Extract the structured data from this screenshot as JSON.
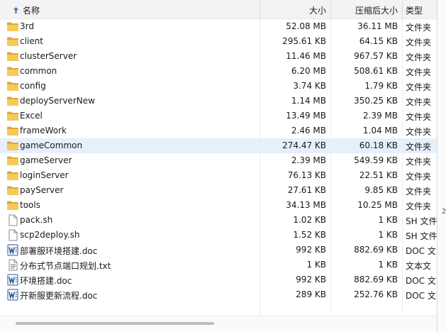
{
  "columns": {
    "name": "名称",
    "size": "大小",
    "compressed": "压缩后大小",
    "type": "类型"
  },
  "files": [
    {
      "name": "3rd",
      "size": "52.08 MB",
      "compressed": "36.11 MB",
      "type": "文件夹",
      "icon": "folder-icon"
    },
    {
      "name": "client",
      "size": "295.61 KB",
      "compressed": "64.15 KB",
      "type": "文件夹",
      "icon": "folder-icon"
    },
    {
      "name": "clusterServer",
      "size": "11.46 MB",
      "compressed": "967.57 KB",
      "type": "文件夹",
      "icon": "folder-icon"
    },
    {
      "name": "common",
      "size": "6.20 MB",
      "compressed": "508.61 KB",
      "type": "文件夹",
      "icon": "folder-icon"
    },
    {
      "name": "config",
      "size": "3.74 KB",
      "compressed": "1.79 KB",
      "type": "文件夹",
      "icon": "folder-icon"
    },
    {
      "name": "deployServerNew",
      "size": "1.14 MB",
      "compressed": "350.25 KB",
      "type": "文件夹",
      "icon": "folder-icon"
    },
    {
      "name": "Excel",
      "size": "13.49 MB",
      "compressed": "2.39 MB",
      "type": "文件夹",
      "icon": "folder-icon"
    },
    {
      "name": "frameWork",
      "size": "2.46 MB",
      "compressed": "1.04 MB",
      "type": "文件夹",
      "icon": "folder-icon"
    },
    {
      "name": "gameCommon",
      "size": "274.47 KB",
      "compressed": "60.18 KB",
      "type": "文件夹",
      "icon": "folder-icon",
      "selected": true
    },
    {
      "name": "gameServer",
      "size": "2.39 MB",
      "compressed": "549.59 KB",
      "type": "文件夹",
      "icon": "folder-icon"
    },
    {
      "name": "loginServer",
      "size": "76.13 KB",
      "compressed": "22.51 KB",
      "type": "文件夹",
      "icon": "folder-icon"
    },
    {
      "name": "payServer",
      "size": "27.61 KB",
      "compressed": "9.85 KB",
      "type": "文件夹",
      "icon": "folder-icon"
    },
    {
      "name": "tools",
      "size": "34.13 MB",
      "compressed": "10.25 MB",
      "type": "文件夹",
      "icon": "folder-icon"
    },
    {
      "name": "pack.sh",
      "size": "1.02 KB",
      "compressed": "1 KB",
      "type": "SH 文件",
      "icon": "file-icon"
    },
    {
      "name": "scp2deploy.sh",
      "size": "1.52 KB",
      "compressed": "1 KB",
      "type": "SH 文件",
      "icon": "file-icon"
    },
    {
      "name": "部署服环境搭建.doc",
      "size": "992 KB",
      "compressed": "882.69 KB",
      "type": "DOC 文",
      "icon": "word-doc-icon"
    },
    {
      "name": "分布式节点端口规划.txt",
      "size": "1 KB",
      "compressed": "1 KB",
      "type": "文本文",
      "icon": "text-file-icon"
    },
    {
      "name": "环境搭建.doc",
      "size": "992 KB",
      "compressed": "882.69 KB",
      "type": "DOC 文",
      "icon": "word-doc-icon"
    },
    {
      "name": "开新服更新流程.doc",
      "size": "289 KB",
      "compressed": "252.76 KB",
      "type": "DOC 文",
      "icon": "word-doc-icon"
    }
  ],
  "edge_mark": "2",
  "colors": {
    "folder": "#f2c14e",
    "folder_dark": "#e0a82e",
    "word": "#2b579a",
    "selected_row": "#e5f0fb",
    "header_bg": "#f3f3f3"
  }
}
